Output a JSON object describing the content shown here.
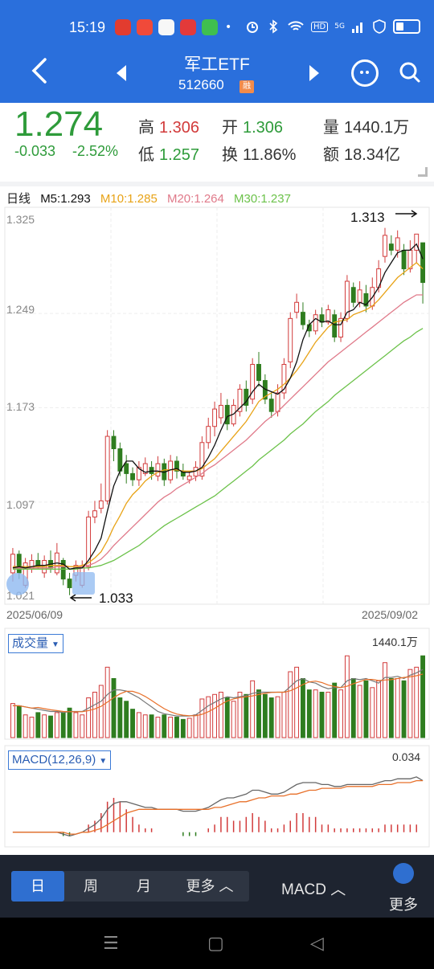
{
  "status": {
    "time": "15:19",
    "net": "HD",
    "signal": "5G"
  },
  "nav": {
    "title": "军工ETF",
    "code": "512660",
    "badge": "融"
  },
  "quote": {
    "price": "1.274",
    "change": "-0.033",
    "change_pct": "-2.52%",
    "high_label": "高",
    "high": "1.306",
    "open_label": "开",
    "open": "1.306",
    "vol_label": "量",
    "vol": "1440.1万",
    "low_label": "低",
    "low": "1.257",
    "turn_label": "换",
    "turn": "11.86%",
    "amt_label": "额",
    "amt": "18.34亿"
  },
  "ma": {
    "period": "日线",
    "m5": "M5:1.293",
    "m10": "M10:1.285",
    "m20": "M20:1.264",
    "m30": "M30:1.237"
  },
  "colors": {
    "up": "#d23b3b",
    "down": "#2e7d1f",
    "ma5": "#111111",
    "ma10": "#e8a317",
    "ma20": "#e07a8a",
    "ma30": "#6cc24a"
  },
  "chart_data": [
    {
      "type": "candlestick",
      "y_ticks": [
        "1.325",
        "1.249",
        "1.173",
        "1.097",
        "1.021"
      ],
      "x_start": "2025/06/09",
      "x_end": "2025/09/02",
      "annotations": [
        "1.313",
        "1.033"
      ],
      "candles": [
        [
          1.04,
          1.055,
          1.06,
          1.033,
          "u"
        ],
        [
          1.055,
          1.04,
          1.058,
          1.035,
          "d"
        ],
        [
          1.03,
          1.048,
          1.052,
          1.028,
          "u"
        ],
        [
          1.043,
          1.05,
          1.055,
          1.04,
          "u"
        ],
        [
          1.05,
          1.045,
          1.056,
          1.043,
          "d"
        ],
        [
          1.04,
          1.05,
          1.054,
          1.036,
          "u"
        ],
        [
          1.05,
          1.044,
          1.058,
          1.04,
          "d"
        ],
        [
          1.04,
          1.056,
          1.064,
          1.038,
          "u"
        ],
        [
          1.05,
          1.035,
          1.052,
          1.03,
          "d"
        ],
        [
          1.035,
          1.028,
          1.04,
          1.022,
          "d"
        ],
        [
          1.038,
          1.046,
          1.05,
          1.033,
          "u"
        ],
        [
          1.03,
          1.045,
          1.05,
          1.028,
          "u"
        ],
        [
          1.045,
          1.085,
          1.09,
          1.042,
          "u"
        ],
        [
          1.085,
          1.09,
          1.098,
          1.08,
          "u"
        ],
        [
          1.092,
          1.098,
          1.112,
          1.088,
          "u"
        ],
        [
          1.098,
          1.15,
          1.155,
          1.095,
          "u"
        ],
        [
          1.15,
          1.14,
          1.155,
          1.13,
          "d"
        ],
        [
          1.14,
          1.122,
          1.145,
          1.118,
          "d"
        ],
        [
          1.128,
          1.12,
          1.135,
          1.112,
          "d"
        ],
        [
          1.12,
          1.115,
          1.125,
          1.11,
          "d"
        ],
        [
          1.115,
          1.125,
          1.13,
          1.11,
          "u"
        ],
        [
          1.12,
          1.128,
          1.133,
          1.118,
          "u"
        ],
        [
          1.125,
          1.12,
          1.13,
          1.115,
          "d"
        ],
        [
          1.118,
          1.128,
          1.134,
          1.114,
          "u"
        ],
        [
          1.128,
          1.115,
          1.132,
          1.11,
          "d"
        ],
        [
          1.115,
          1.13,
          1.135,
          1.112,
          "u"
        ],
        [
          1.13,
          1.122,
          1.134,
          1.116,
          "d"
        ],
        [
          1.122,
          1.118,
          1.128,
          1.115,
          "d"
        ],
        [
          1.115,
          1.118,
          1.122,
          1.112,
          "u"
        ],
        [
          1.118,
          1.125,
          1.13,
          1.114,
          "u"
        ],
        [
          1.118,
          1.145,
          1.15,
          1.115,
          "u"
        ],
        [
          1.145,
          1.158,
          1.165,
          1.14,
          "u"
        ],
        [
          1.158,
          1.172,
          1.178,
          1.15,
          "u"
        ],
        [
          1.165,
          1.175,
          1.185,
          1.16,
          "u"
        ],
        [
          1.175,
          1.16,
          1.18,
          1.155,
          "d"
        ],
        [
          1.16,
          1.175,
          1.18,
          1.158,
          "u"
        ],
        [
          1.17,
          1.188,
          1.192,
          1.166,
          "u"
        ],
        [
          1.188,
          1.175,
          1.195,
          1.17,
          "d"
        ],
        [
          1.18,
          1.208,
          1.213,
          1.176,
          "u"
        ],
        [
          1.208,
          1.195,
          1.218,
          1.19,
          "d"
        ],
        [
          1.195,
          1.18,
          1.2,
          1.176,
          "d"
        ],
        [
          1.18,
          1.17,
          1.186,
          1.165,
          "d"
        ],
        [
          1.17,
          1.185,
          1.192,
          1.166,
          "u"
        ],
        [
          1.185,
          1.208,
          1.213,
          1.18,
          "u"
        ],
        [
          1.21,
          1.245,
          1.25,
          1.205,
          "u"
        ],
        [
          1.25,
          1.258,
          1.265,
          1.245,
          "u"
        ],
        [
          1.25,
          1.24,
          1.258,
          1.236,
          "d"
        ],
        [
          1.24,
          1.235,
          1.244,
          1.23,
          "d"
        ],
        [
          1.235,
          1.248,
          1.252,
          1.232,
          "u"
        ],
        [
          1.248,
          1.242,
          1.254,
          1.238,
          "d"
        ],
        [
          1.242,
          1.252,
          1.256,
          1.24,
          "u"
        ],
        [
          1.248,
          1.23,
          1.252,
          1.226,
          "d"
        ],
        [
          1.23,
          1.245,
          1.25,
          1.226,
          "u"
        ],
        [
          1.245,
          1.275,
          1.28,
          1.242,
          "u"
        ],
        [
          1.27,
          1.258,
          1.274,
          1.254,
          "d"
        ],
        [
          1.258,
          1.268,
          1.275,
          1.254,
          "u"
        ],
        [
          1.265,
          1.255,
          1.272,
          1.25,
          "d"
        ],
        [
          1.255,
          1.27,
          1.278,
          1.252,
          "u"
        ],
        [
          1.27,
          1.285,
          1.292,
          1.266,
          "u"
        ],
        [
          1.295,
          1.312,
          1.318,
          1.29,
          "u"
        ],
        [
          1.305,
          1.3,
          1.312,
          1.296,
          "d"
        ],
        [
          1.3,
          1.31,
          1.316,
          1.294,
          "u"
        ],
        [
          1.3,
          1.285,
          1.305,
          1.28,
          "d"
        ],
        [
          1.285,
          1.3,
          1.308,
          1.282,
          "u"
        ],
        [
          1.3,
          1.313,
          1.313,
          1.29,
          "u"
        ],
        [
          1.306,
          1.274,
          1.306,
          1.257,
          "d"
        ]
      ],
      "ma5": [
        1.044,
        1.045,
        1.044,
        1.045,
        1.046,
        1.046,
        1.047,
        1.048,
        1.047,
        1.043,
        1.044,
        1.044,
        1.05,
        1.058,
        1.068,
        1.09,
        1.11,
        1.122,
        1.13,
        1.13,
        1.124,
        1.121,
        1.122,
        1.122,
        1.121,
        1.123,
        1.124,
        1.121,
        1.121,
        1.122,
        1.125,
        1.133,
        1.143,
        1.155,
        1.166,
        1.168,
        1.173,
        1.178,
        1.186,
        1.192,
        1.188,
        1.186,
        1.184,
        1.188,
        1.197,
        1.21,
        1.228,
        1.24,
        1.245,
        1.242,
        1.243,
        1.24,
        1.24,
        1.25,
        1.252,
        1.258,
        1.256,
        1.262,
        1.27,
        1.282,
        1.29,
        1.298,
        1.3,
        1.3,
        1.305,
        1.293
      ],
      "ma10": [
        1.045,
        1.045,
        1.045,
        1.045,
        1.045,
        1.045,
        1.046,
        1.046,
        1.046,
        1.045,
        1.045,
        1.046,
        1.048,
        1.052,
        1.057,
        1.066,
        1.077,
        1.086,
        1.096,
        1.103,
        1.108,
        1.114,
        1.118,
        1.121,
        1.123,
        1.123,
        1.123,
        1.122,
        1.122,
        1.122,
        1.124,
        1.128,
        1.132,
        1.138,
        1.144,
        1.15,
        1.156,
        1.162,
        1.17,
        1.178,
        1.182,
        1.185,
        1.188,
        1.192,
        1.197,
        1.203,
        1.21,
        1.218,
        1.226,
        1.232,
        1.238,
        1.242,
        1.243,
        1.244,
        1.248,
        1.25,
        1.252,
        1.255,
        1.26,
        1.266,
        1.272,
        1.278,
        1.282,
        1.286,
        1.29,
        1.285
      ],
      "ma20": [
        1.044,
        1.044,
        1.044,
        1.044,
        1.044,
        1.044,
        1.044,
        1.045,
        1.045,
        1.045,
        1.045,
        1.045,
        1.046,
        1.048,
        1.051,
        1.056,
        1.062,
        1.067,
        1.072,
        1.077,
        1.082,
        1.087,
        1.092,
        1.097,
        1.101,
        1.104,
        1.108,
        1.111,
        1.114,
        1.117,
        1.12,
        1.124,
        1.127,
        1.131,
        1.135,
        1.139,
        1.143,
        1.147,
        1.152,
        1.157,
        1.162,
        1.166,
        1.17,
        1.175,
        1.18,
        1.185,
        1.19,
        1.195,
        1.2,
        1.205,
        1.21,
        1.214,
        1.218,
        1.222,
        1.226,
        1.23,
        1.234,
        1.238,
        1.242,
        1.246,
        1.25,
        1.254,
        1.258,
        1.261,
        1.264,
        1.264
      ],
      "ma30": [
        1.043,
        1.043,
        1.043,
        1.043,
        1.043,
        1.043,
        1.043,
        1.043,
        1.043,
        1.043,
        1.043,
        1.044,
        1.044,
        1.045,
        1.046,
        1.048,
        1.05,
        1.053,
        1.056,
        1.059,
        1.062,
        1.066,
        1.07,
        1.074,
        1.078,
        1.081,
        1.084,
        1.087,
        1.09,
        1.093,
        1.096,
        1.099,
        1.102,
        1.106,
        1.11,
        1.114,
        1.118,
        1.122,
        1.126,
        1.131,
        1.135,
        1.139,
        1.143,
        1.147,
        1.152,
        1.156,
        1.16,
        1.165,
        1.17,
        1.174,
        1.178,
        1.183,
        1.187,
        1.191,
        1.195,
        1.199,
        1.203,
        1.207,
        1.211,
        1.215,
        1.219,
        1.223,
        1.227,
        1.23,
        1.234,
        1.237
      ]
    },
    {
      "type": "bar",
      "title": "成交量",
      "max_label": "1440.1万",
      "values": [
        0.3,
        0.28,
        0.2,
        0.18,
        0.22,
        0.2,
        0.19,
        0.22,
        0.22,
        0.26,
        0.22,
        0.2,
        0.35,
        0.4,
        0.46,
        0.62,
        0.52,
        0.35,
        0.32,
        0.25,
        0.22,
        0.2,
        0.2,
        0.18,
        0.2,
        0.18,
        0.18,
        0.16,
        0.17,
        0.2,
        0.34,
        0.36,
        0.38,
        0.4,
        0.35,
        0.32,
        0.4,
        0.38,
        0.5,
        0.42,
        0.38,
        0.35,
        0.36,
        0.4,
        0.58,
        0.62,
        0.52,
        0.42,
        0.42,
        0.4,
        0.4,
        0.48,
        0.42,
        0.72,
        0.52,
        0.46,
        0.5,
        0.44,
        0.5,
        0.66,
        0.52,
        0.52,
        0.5,
        0.6,
        0.62,
        0.72
      ],
      "avg": [
        0.28,
        0.28,
        0.27,
        0.26,
        0.25,
        0.24,
        0.23,
        0.23,
        0.22,
        0.23,
        0.23,
        0.23,
        0.26,
        0.29,
        0.32,
        0.38,
        0.42,
        0.42,
        0.41,
        0.38,
        0.35,
        0.31,
        0.27,
        0.23,
        0.21,
        0.2,
        0.19,
        0.19,
        0.19,
        0.2,
        0.24,
        0.28,
        0.31,
        0.34,
        0.36,
        0.35,
        0.36,
        0.37,
        0.39,
        0.4,
        0.4,
        0.4,
        0.4,
        0.4,
        0.45,
        0.5,
        0.52,
        0.49,
        0.48,
        0.45,
        0.43,
        0.44,
        0.44,
        0.5,
        0.52,
        0.51,
        0.52,
        0.5,
        0.48,
        0.53,
        0.53,
        0.54,
        0.52,
        0.55,
        0.57,
        0.6
      ]
    },
    {
      "type": "line",
      "title": "MACD(12,26,9)",
      "max_label": "0.034",
      "dif": [
        0.0,
        0.0,
        0.0,
        0.0,
        0.0,
        0.0,
        0.0,
        0.0,
        -0.001,
        -0.002,
        -0.001,
        0.0,
        0.002,
        0.004,
        0.007,
        0.012,
        0.015,
        0.016,
        0.016,
        0.015,
        0.014,
        0.013,
        0.013,
        0.012,
        0.012,
        0.012,
        0.012,
        0.011,
        0.011,
        0.011,
        0.012,
        0.013,
        0.015,
        0.017,
        0.018,
        0.018,
        0.019,
        0.02,
        0.022,
        0.022,
        0.021,
        0.02,
        0.02,
        0.021,
        0.023,
        0.025,
        0.026,
        0.026,
        0.026,
        0.025,
        0.025,
        0.024,
        0.024,
        0.025,
        0.025,
        0.025,
        0.025,
        0.025,
        0.026,
        0.027,
        0.027,
        0.028,
        0.028,
        0.028,
        0.029,
        0.027
      ],
      "dea": [
        0.0,
        0.0,
        0.0,
        0.0,
        0.0,
        0.0,
        0.0,
        0.0,
        0.0,
        -0.001,
        -0.001,
        0.0,
        0.0,
        0.001,
        0.002,
        0.004,
        0.006,
        0.008,
        0.01,
        0.011,
        0.012,
        0.012,
        0.012,
        0.012,
        0.012,
        0.012,
        0.012,
        0.012,
        0.012,
        0.012,
        0.012,
        0.012,
        0.013,
        0.013,
        0.014,
        0.015,
        0.016,
        0.016,
        0.017,
        0.018,
        0.018,
        0.019,
        0.019,
        0.019,
        0.02,
        0.02,
        0.021,
        0.022,
        0.022,
        0.023,
        0.023,
        0.023,
        0.023,
        0.024,
        0.024,
        0.024,
        0.024,
        0.024,
        0.025,
        0.025,
        0.025,
        0.026,
        0.026,
        0.026,
        0.027,
        0.027
      ]
    }
  ],
  "subcharts": {
    "vol_label": "成交量",
    "vol_max": "1440.1万",
    "macd_label": "MACD(12,26,9)",
    "macd_max": "0.034"
  },
  "tabs": {
    "day": "日",
    "week": "周",
    "month": "月",
    "more": "更多"
  },
  "bottom": {
    "indicator": "MACD",
    "more": "更多"
  }
}
